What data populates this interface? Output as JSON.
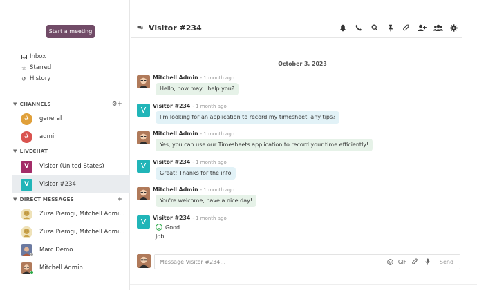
{
  "sidebar": {
    "start_meeting": "Start a meeting",
    "mailboxes": [
      {
        "icon": "inbox-icon",
        "label": "Inbox",
        "glyph": "▭"
      },
      {
        "icon": "star-icon",
        "label": "Starred",
        "glyph": "☆"
      },
      {
        "icon": "history-icon",
        "label": "History",
        "glyph": "↺"
      }
    ],
    "channels_header": "CHANNELS",
    "channels": [
      {
        "label": "general",
        "color": "#e0a03a"
      },
      {
        "label": "admin",
        "color": "#d9534f"
      }
    ],
    "livechat_header": "LIVECHAT",
    "livechats": [
      {
        "label": "Visitor (United States)",
        "letter": "V",
        "color": "#a32c68"
      },
      {
        "label": "Visitor #234",
        "letter": "V",
        "color": "#21b5b8"
      }
    ],
    "dm_header": "DIRECT MESSAGES",
    "dms": [
      {
        "label": "Zuza Pierogi, Mitchell Admin, a..."
      },
      {
        "label": "Zuza Pierogi, Mitchell Admin, a..."
      },
      {
        "label": "Marc Demo"
      },
      {
        "label": "Mitchell Admin"
      }
    ]
  },
  "header": {
    "title": "Visitor #234",
    "actions": [
      {
        "icon": "bell-icon",
        "glyph": "🔔"
      },
      {
        "icon": "phone-icon",
        "glyph": "✆"
      },
      {
        "icon": "search-icon",
        "glyph": "⚲"
      },
      {
        "icon": "pin-icon",
        "glyph": "📌"
      },
      {
        "icon": "paperclip-icon",
        "glyph": "📎"
      },
      {
        "icon": "add-user-icon",
        "glyph": "👤"
      },
      {
        "icon": "members-icon",
        "glyph": "👥"
      },
      {
        "icon": "gear-icon",
        "glyph": "⚙"
      }
    ]
  },
  "thread": {
    "date": "October 3, 2023",
    "messages": [
      {
        "author": "Mitchell Admin",
        "time": "- 1 month ago",
        "text": "Hello, how may I help you?"
      },
      {
        "author": "Visitor #234",
        "time": "- 1 month ago",
        "text": "I'm looking for an application to record my timesheet, any tips?"
      },
      {
        "author": "Mitchell Admin",
        "time": "- 1 month ago",
        "text": "Yes, you can use our Timesheets application to record your time efficiently!"
      },
      {
        "author": "Visitor #234",
        "time": "- 1 month ago",
        "text": "Great! Thanks for the info"
      },
      {
        "author": "Mitchell Admin",
        "time": "- 1 month ago",
        "text": "You're welcome, have a nice day!"
      },
      {
        "author": "Visitor #234",
        "time": "- 1 month ago",
        "rating": "Good",
        "text": "Job"
      }
    ],
    "visitor_letter": "V"
  },
  "composer": {
    "placeholder": "Message Visitor #234…",
    "gif_label": "GIF",
    "send_label": "Send"
  },
  "colors": {
    "brand": "#714B67",
    "visitor": "#21b5b8",
    "admin_bubble": "#e6f2e8",
    "visitor_bubble": "#e2f2f7"
  }
}
